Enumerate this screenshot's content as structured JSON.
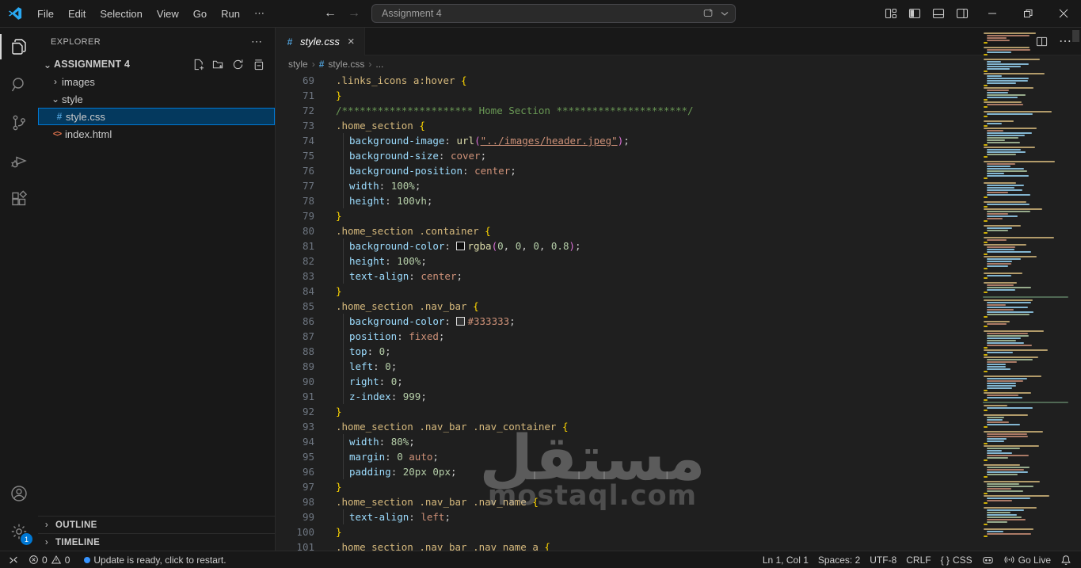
{
  "titlebar": {
    "menus": [
      "File",
      "Edit",
      "Selection",
      "View",
      "Go",
      "Run"
    ],
    "menus_overflow": "⋯",
    "command_center": {
      "value": "Assignment 4"
    }
  },
  "icons": {
    "more_h": "⋯",
    "close": "×",
    "chevron_right": "›",
    "chevron_down": "⌄",
    "arrow_left": "←",
    "arrow_right": "→",
    "hash": "#",
    "angle_brackets": "<>",
    "braces": "{ }"
  },
  "activity_bar": {
    "settings_badge": "1"
  },
  "sidebar": {
    "header": "EXPLORER",
    "section_label": "ASSIGNMENT 4",
    "tree": [
      {
        "label": "images",
        "type": "folder",
        "state": "collapsed"
      },
      {
        "label": "style",
        "type": "folder",
        "state": "expanded"
      },
      {
        "label": "style.css",
        "type": "css-file",
        "selected": true
      },
      {
        "label": "index.html",
        "type": "html-file",
        "selected": false
      }
    ],
    "panels": [
      {
        "label": "OUTLINE"
      },
      {
        "label": "TIMELINE"
      }
    ]
  },
  "editor": {
    "tab": {
      "label": "style.css"
    },
    "breadcrumb": {
      "items": [
        "style",
        "style.css",
        "..."
      ]
    },
    "lines": [
      {
        "n": "69",
        "toks": [
          {
            "t": ".links_icons a:hover ",
            "c": "sel"
          },
          {
            "t": "{",
            "c": "brace"
          }
        ]
      },
      {
        "n": "71",
        "toks": [
          {
            "t": "}",
            "c": "brace"
          }
        ]
      },
      {
        "n": "72",
        "toks": [
          {
            "t": "/********************** Home Section **********************/",
            "c": "cmt"
          }
        ]
      },
      {
        "n": "73",
        "toks": [
          {
            "t": ".home_section ",
            "c": "sel"
          },
          {
            "t": "{",
            "c": "brace"
          }
        ]
      },
      {
        "n": "74",
        "ind": 1,
        "toks": [
          {
            "t": "background-image",
            "c": "prop"
          },
          {
            "t": ": ",
            "c": "punct"
          },
          {
            "t": "url",
            "c": "fn"
          },
          {
            "t": "(",
            "c": "paren"
          },
          {
            "t": "\"../images/header.jpeg\"",
            "c": "str"
          },
          {
            "t": ")",
            "c": "paren"
          },
          {
            "t": ";",
            "c": "punct"
          }
        ]
      },
      {
        "n": "75",
        "ind": 1,
        "toks": [
          {
            "t": "background-size",
            "c": "prop"
          },
          {
            "t": ": ",
            "c": "punct"
          },
          {
            "t": "cover",
            "c": "val"
          },
          {
            "t": ";",
            "c": "punct"
          }
        ]
      },
      {
        "n": "76",
        "ind": 1,
        "toks": [
          {
            "t": "background-position",
            "c": "prop"
          },
          {
            "t": ": ",
            "c": "punct"
          },
          {
            "t": "center",
            "c": "val"
          },
          {
            "t": ";",
            "c": "punct"
          }
        ]
      },
      {
        "n": "77",
        "ind": 1,
        "toks": [
          {
            "t": "width",
            "c": "prop"
          },
          {
            "t": ": ",
            "c": "punct"
          },
          {
            "t": "100%",
            "c": "num"
          },
          {
            "t": ";",
            "c": "punct"
          }
        ]
      },
      {
        "n": "78",
        "ind": 1,
        "toks": [
          {
            "t": "height",
            "c": "prop"
          },
          {
            "t": ": ",
            "c": "punct"
          },
          {
            "t": "100vh",
            "c": "num"
          },
          {
            "t": ";",
            "c": "punct"
          }
        ]
      },
      {
        "n": "79",
        "toks": [
          {
            "t": "}",
            "c": "brace"
          }
        ]
      },
      {
        "n": "80",
        "toks": [
          {
            "t": ".home_section .container ",
            "c": "sel"
          },
          {
            "t": "{",
            "c": "brace"
          }
        ]
      },
      {
        "n": "81",
        "ind": 1,
        "toks": [
          {
            "t": "background-color",
            "c": "prop"
          },
          {
            "t": ": ",
            "c": "punct"
          },
          {
            "sw": "#0d0d0d"
          },
          {
            "t": "rgba",
            "c": "fn"
          },
          {
            "t": "(",
            "c": "paren"
          },
          {
            "t": "0",
            "c": "num"
          },
          {
            "t": ", ",
            "c": "punct"
          },
          {
            "t": "0",
            "c": "num"
          },
          {
            "t": ", ",
            "c": "punct"
          },
          {
            "t": "0",
            "c": "num"
          },
          {
            "t": ", ",
            "c": "punct"
          },
          {
            "t": "0.8",
            "c": "num"
          },
          {
            "t": ")",
            "c": "paren"
          },
          {
            "t": ";",
            "c": "punct"
          }
        ]
      },
      {
        "n": "82",
        "ind": 1,
        "toks": [
          {
            "t": "height",
            "c": "prop"
          },
          {
            "t": ": ",
            "c": "punct"
          },
          {
            "t": "100%",
            "c": "num"
          },
          {
            "t": ";",
            "c": "punct"
          }
        ]
      },
      {
        "n": "83",
        "ind": 1,
        "toks": [
          {
            "t": "text-align",
            "c": "prop"
          },
          {
            "t": ": ",
            "c": "punct"
          },
          {
            "t": "center",
            "c": "val"
          },
          {
            "t": ";",
            "c": "punct"
          }
        ]
      },
      {
        "n": "84",
        "toks": [
          {
            "t": "}",
            "c": "brace"
          }
        ]
      },
      {
        "n": "85",
        "toks": [
          {
            "t": ".home_section .nav_bar ",
            "c": "sel"
          },
          {
            "t": "{",
            "c": "brace"
          }
        ]
      },
      {
        "n": "86",
        "ind": 1,
        "toks": [
          {
            "t": "background-color",
            "c": "prop"
          },
          {
            "t": ": ",
            "c": "punct"
          },
          {
            "sw": "#333333"
          },
          {
            "t": "#333333",
            "c": "val"
          },
          {
            "t": ";",
            "c": "punct"
          }
        ]
      },
      {
        "n": "87",
        "ind": 1,
        "toks": [
          {
            "t": "position",
            "c": "prop"
          },
          {
            "t": ": ",
            "c": "punct"
          },
          {
            "t": "fixed",
            "c": "val"
          },
          {
            "t": ";",
            "c": "punct"
          }
        ]
      },
      {
        "n": "88",
        "ind": 1,
        "toks": [
          {
            "t": "top",
            "c": "prop"
          },
          {
            "t": ": ",
            "c": "punct"
          },
          {
            "t": "0",
            "c": "num"
          },
          {
            "t": ";",
            "c": "punct"
          }
        ]
      },
      {
        "n": "89",
        "ind": 1,
        "toks": [
          {
            "t": "left",
            "c": "prop"
          },
          {
            "t": ": ",
            "c": "punct"
          },
          {
            "t": "0",
            "c": "num"
          },
          {
            "t": ";",
            "c": "punct"
          }
        ]
      },
      {
        "n": "90",
        "ind": 1,
        "toks": [
          {
            "t": "right",
            "c": "prop"
          },
          {
            "t": ": ",
            "c": "punct"
          },
          {
            "t": "0",
            "c": "num"
          },
          {
            "t": ";",
            "c": "punct"
          }
        ]
      },
      {
        "n": "91",
        "ind": 1,
        "toks": [
          {
            "t": "z-index",
            "c": "prop"
          },
          {
            "t": ": ",
            "c": "punct"
          },
          {
            "t": "999",
            "c": "num"
          },
          {
            "t": ";",
            "c": "punct"
          }
        ]
      },
      {
        "n": "92",
        "toks": [
          {
            "t": "}",
            "c": "brace"
          }
        ]
      },
      {
        "n": "93",
        "toks": [
          {
            "t": ".home_section .nav_bar .nav_container ",
            "c": "sel"
          },
          {
            "t": "{",
            "c": "brace"
          }
        ]
      },
      {
        "n": "94",
        "ind": 1,
        "toks": [
          {
            "t": "width",
            "c": "prop"
          },
          {
            "t": ": ",
            "c": "punct"
          },
          {
            "t": "80%",
            "c": "num"
          },
          {
            "t": ";",
            "c": "punct"
          }
        ]
      },
      {
        "n": "95",
        "ind": 1,
        "toks": [
          {
            "t": "margin",
            "c": "prop"
          },
          {
            "t": ": ",
            "c": "punct"
          },
          {
            "t": "0",
            "c": "num"
          },
          {
            "t": " ",
            "c": "punct"
          },
          {
            "t": "auto",
            "c": "val"
          },
          {
            "t": ";",
            "c": "punct"
          }
        ]
      },
      {
        "n": "96",
        "ind": 1,
        "toks": [
          {
            "t": "padding",
            "c": "prop"
          },
          {
            "t": ": ",
            "c": "punct"
          },
          {
            "t": "20px",
            "c": "num"
          },
          {
            "t": " ",
            "c": "punct"
          },
          {
            "t": "0px",
            "c": "num"
          },
          {
            "t": ";",
            "c": "punct"
          }
        ]
      },
      {
        "n": "97",
        "toks": [
          {
            "t": "}",
            "c": "brace"
          }
        ]
      },
      {
        "n": "98",
        "toks": [
          {
            "t": ".home_section .nav_bar .nav_name ",
            "c": "sel"
          },
          {
            "t": "{",
            "c": "brace"
          }
        ]
      },
      {
        "n": "99",
        "ind": 1,
        "toks": [
          {
            "t": "text-align",
            "c": "prop"
          },
          {
            "t": ": ",
            "c": "punct"
          },
          {
            "t": "left",
            "c": "val"
          },
          {
            "t": ";",
            "c": "punct"
          }
        ]
      },
      {
        "n": "100",
        "toks": [
          {
            "t": "}",
            "c": "brace"
          }
        ]
      },
      {
        "n": "101",
        "toks": [
          {
            "t": ".home_section .nav_bar .nav_name a ",
            "c": "sel"
          },
          {
            "t": "{",
            "c": "brace"
          }
        ]
      }
    ]
  },
  "watermark": {
    "arabic": "مستقل",
    "latin": "mostaql.com"
  },
  "statusbar": {
    "errors": "0",
    "warnings": "0",
    "message": "Update is ready, click to restart.",
    "cursor": "Ln 1, Col 1",
    "indentation": "Spaces: 2",
    "encoding": "UTF-8",
    "eol": "CRLF",
    "language": "CSS",
    "live_server": "Go Live"
  },
  "colors": {
    "accent": "#0078d4",
    "selection_bg": "#04395e",
    "editor_bg": "#1f1f1f",
    "chrome_bg": "#181818",
    "badge_bg": "#0078d4"
  }
}
